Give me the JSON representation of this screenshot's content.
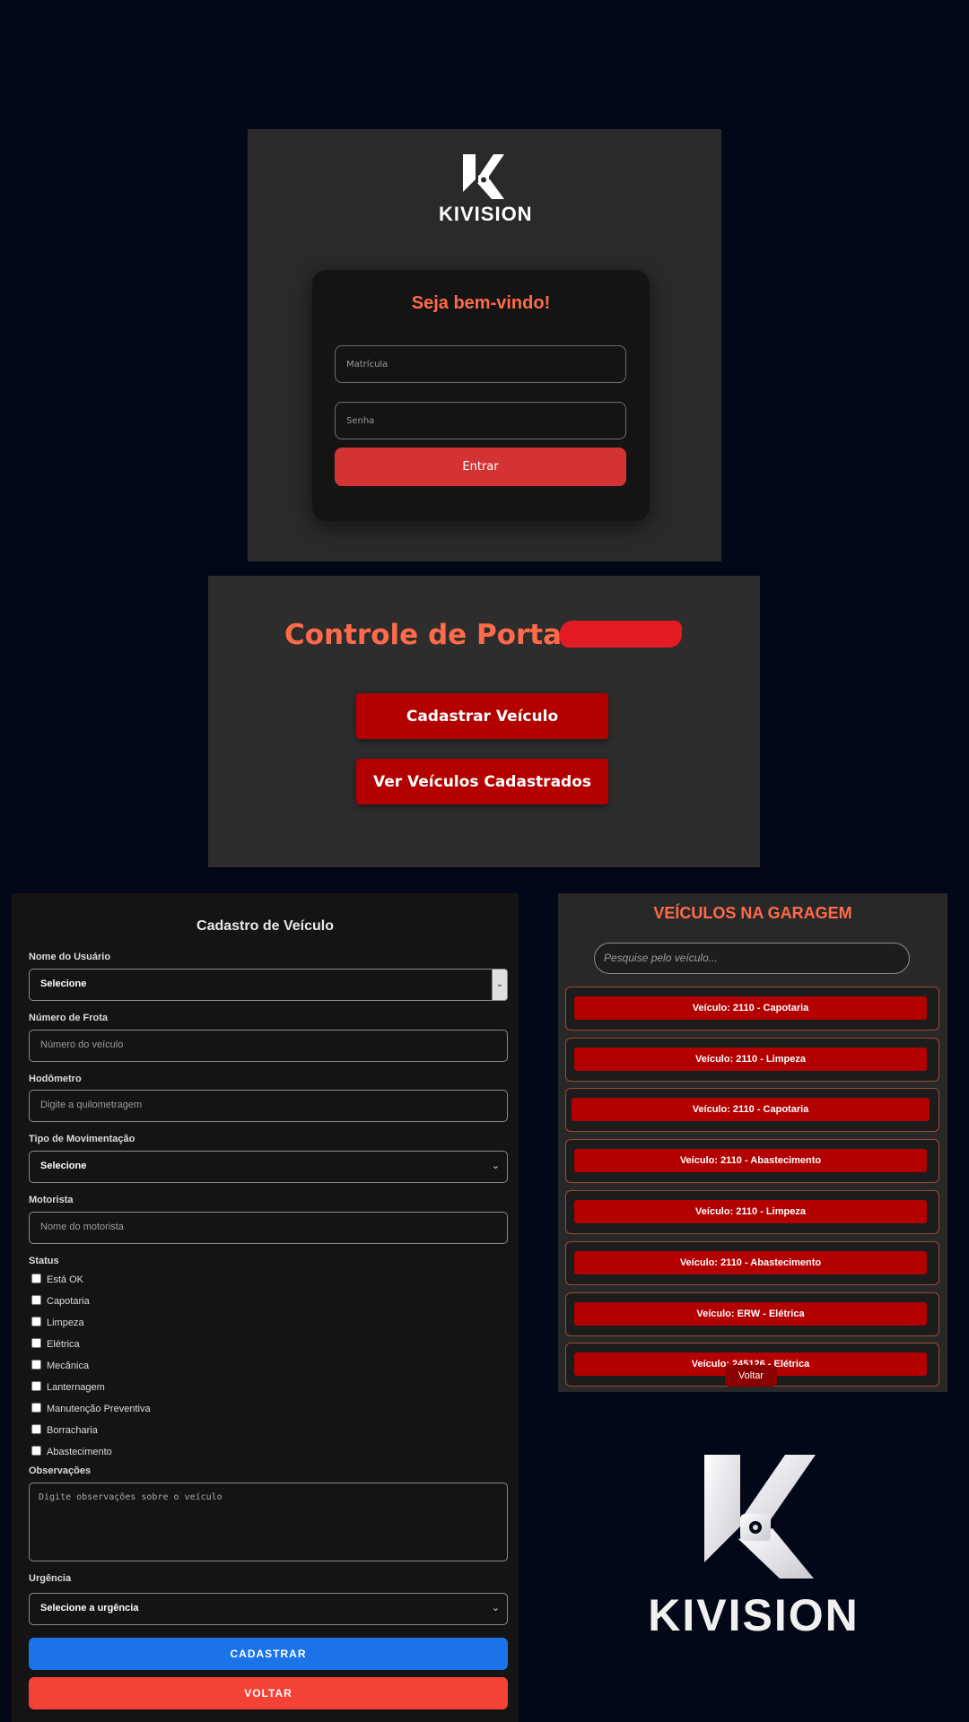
{
  "login": {
    "brand": "KIVISION",
    "title": "Seja bem-vindo!",
    "matricula_placeholder": "Matrícula",
    "senha_placeholder": "Senha",
    "submit_label": "Entrar"
  },
  "portaria": {
    "title": "Controle de Portaria",
    "cadastrar_label": "Cadastrar Veículo",
    "ver_label": "Ver Veículos Cadastrados"
  },
  "cadastro": {
    "title": "Cadastro de Veículo",
    "usuario_label": "Nome do Usuário",
    "usuario_value": "Selecione",
    "frota_label": "Número de Frota",
    "frota_placeholder": "Número do veículo",
    "hodometro_label": "Hodômetro",
    "hodometro_placeholder": "Digite a quilometragem",
    "movimentacao_label": "Tipo de Movimentação",
    "movimentacao_value": "Selecione",
    "motorista_label": "Motorista",
    "motorista_placeholder": "Nome do motorista",
    "status_label": "Status",
    "status_options": [
      "Está OK",
      "Capotaria",
      "Limpeza",
      "Elétrica",
      "Mecânica",
      "Lanternagem",
      "Manutenção Preventiva",
      "Borracharia",
      "Abastecimento"
    ],
    "observacoes_label": "Observações",
    "observacoes_placeholder": "Digite observações sobre o veículo",
    "urgencia_label": "Urgência",
    "urgencia_value": "Selecione a urgência",
    "cadastrar_label": "CADASTRAR",
    "voltar_label": "VOLTAR"
  },
  "garagem": {
    "title": "VEÍCULOS NA GARAGEM",
    "search_placeholder": "Pesquise pelo veículo...",
    "vehicles": [
      "Veículo: 2110 - Capotaria",
      "Veículo: 2110 - Limpeza",
      "Veículo: 2110 - Capotaria",
      "Veículo: 2110 - Abastecimento",
      "Veículo: 2110 - Limpeza",
      "Veículo: 2110 - Abastecimento",
      "Veículo: ERW - Elétrica",
      "Veículo: 245126 - Elétrica"
    ],
    "voltar_label": "Voltar"
  },
  "footer_logo": {
    "brand": "KIVISION"
  },
  "colors": {
    "background": "#030818",
    "accent_orange": "#ff6b4a",
    "red_button": "#b30000",
    "login_button": "#d43333",
    "blue_button": "#1a73e8",
    "orange_button": "#f44336"
  }
}
